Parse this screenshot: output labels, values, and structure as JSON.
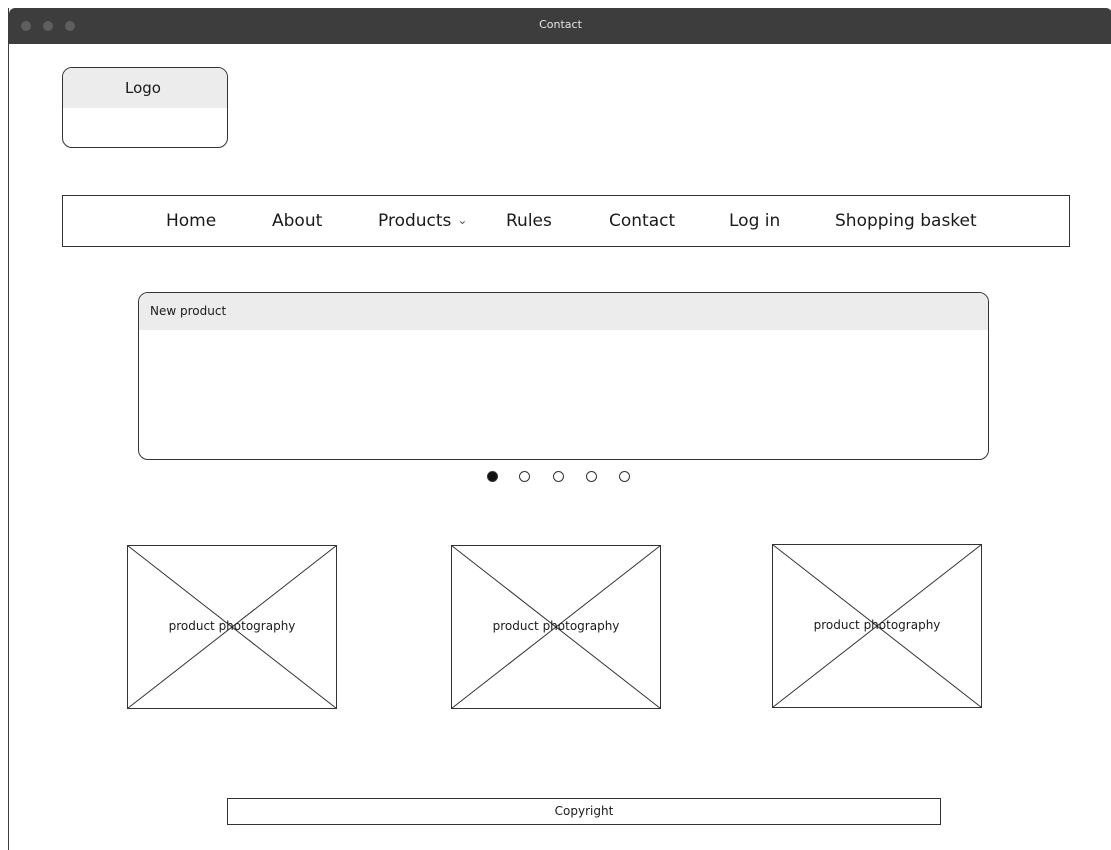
{
  "window": {
    "title": "Contact"
  },
  "logo": {
    "label": "Logo"
  },
  "nav": {
    "items": [
      {
        "label": "Home"
      },
      {
        "label": "About"
      },
      {
        "label": "Products",
        "has_dropdown": true
      },
      {
        "label": "Rules"
      },
      {
        "label": "Contact"
      },
      {
        "label": "Log in"
      },
      {
        "label": "Shopping basket"
      }
    ]
  },
  "carousel": {
    "title": "New product",
    "slide_count": 5,
    "active_slide": 1
  },
  "products": [
    {
      "label": "product photography"
    },
    {
      "label": "product photography"
    },
    {
      "label": "product photography"
    }
  ],
  "footer": {
    "text": "Copyright"
  }
}
